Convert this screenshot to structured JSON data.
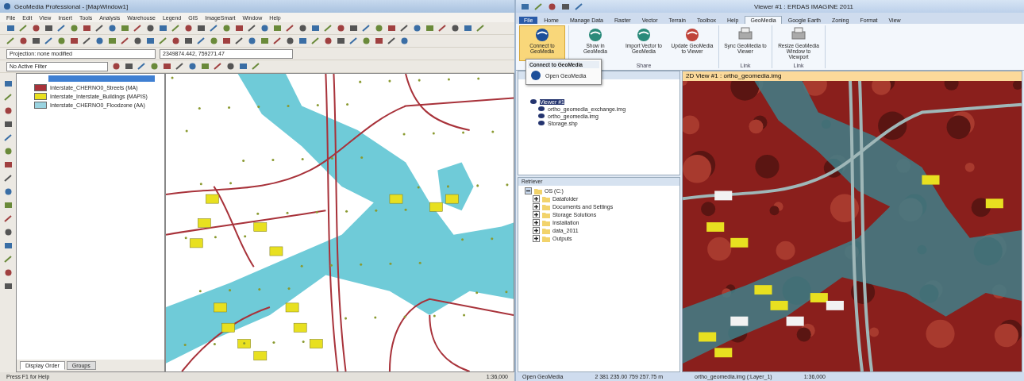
{
  "left_window": {
    "title": "GeoMedia Professional - [MapWindow1]",
    "menu": [
      "File",
      "Edit",
      "View",
      "Insert",
      "Tools",
      "Analysis",
      "Warehouse",
      "Legend",
      "GIS",
      "ImageSmart",
      "Window",
      "Help"
    ],
    "projection_field": {
      "value": "Projection: none modified"
    },
    "coordinate_field": {
      "value": "2349874.442, 759271.47"
    },
    "feature_field": {
      "value": "No Active Filter"
    },
    "legend": [
      {
        "label": "Interstate_CHERNO0_Streets (MA)"
      },
      {
        "label": "Interstate_Interstate_Buildings (MAPIS)"
      },
      {
        "label": "Interstate_CHERNO0_Floodzone (AA)"
      }
    ],
    "bottom_tabs": [
      {
        "label": "Display Order",
        "selected": true
      },
      {
        "label": "Groups",
        "selected": false
      }
    ],
    "status": "Press F1 for Help",
    "scale": "1:36,000"
  },
  "right_window": {
    "title": "Viewer #1 : ERDAS IMAGINE 2011",
    "tabs": [
      {
        "label": "File",
        "selected": false
      },
      {
        "label": "Home",
        "selected": false
      },
      {
        "label": "Manage Data",
        "selected": false
      },
      {
        "label": "Raster",
        "selected": false
      },
      {
        "label": "Vector",
        "selected": false
      },
      {
        "label": "Terrain",
        "selected": false
      },
      {
        "label": "Toolbox",
        "selected": false
      },
      {
        "label": "Help",
        "selected": false
      },
      {
        "label": "GeoMedia",
        "selected": true
      },
      {
        "label": "Google Earth",
        "selected": false
      },
      {
        "label": "Zoning",
        "selected": false
      },
      {
        "label": "Format",
        "selected": false
      },
      {
        "label": "View",
        "selected": false
      }
    ],
    "ribbon_groups": [
      {
        "buttons": [
          {
            "label": "Connect to GeoMedia",
            "selected": true
          }
        ]
      },
      {
        "label": "Share",
        "buttons": [
          {
            "label": "Show in GeoMedia",
            "selected": false
          },
          {
            "label": "Import Vector to GeoMedia",
            "selected": false
          },
          {
            "label": "Update GeoMedia to Viewer",
            "selected": false
          }
        ]
      },
      {
        "label": "Link",
        "buttons": [
          {
            "label": "Sync GeoMedia to Viewer",
            "selected": false
          }
        ]
      },
      {
        "label": "Link",
        "buttons": [
          {
            "label": "Resize GeoMedia Window to Viewport",
            "selected": false
          }
        ]
      }
    ],
    "dropdown": {
      "title": "Connect to GeoMedia",
      "items": [
        "Open GeoMedia"
      ]
    },
    "contents": {
      "items": [
        {
          "label": "Viewer #1",
          "selected": true,
          "children": [
            {
              "label": "ortho_geomedia_exchange.img",
              "selected": false
            },
            {
              "label": "ortho_geomedia.img",
              "selected": false
            },
            {
              "label": "Storage.shp",
              "selected": false
            }
          ]
        }
      ]
    },
    "retriever": {
      "title": "Retriever",
      "items": [
        {
          "label": "OS (C:)",
          "expanded": true,
          "children": [
            {
              "label": "Datafolder",
              "expanded": false
            },
            {
              "label": "Documents and Settings",
              "expanded": false
            },
            {
              "label": "Storage Solutions",
              "expanded": false
            },
            {
              "label": "Installation",
              "expanded": false
            },
            {
              "label": "data_2011",
              "expanded": false
            },
            {
              "label": "Outputs",
              "expanded": false
            }
          ]
        }
      ]
    },
    "viewer_title": "2D View #1 : ortho_geomedia.img",
    "status": "Open GeoMedia",
    "coordinates": "2 381 235.00 759 257.75 m",
    "file_info": "ortho_geomedia.img (:Layer_1)",
    "zoom": "1:36,000"
  }
}
